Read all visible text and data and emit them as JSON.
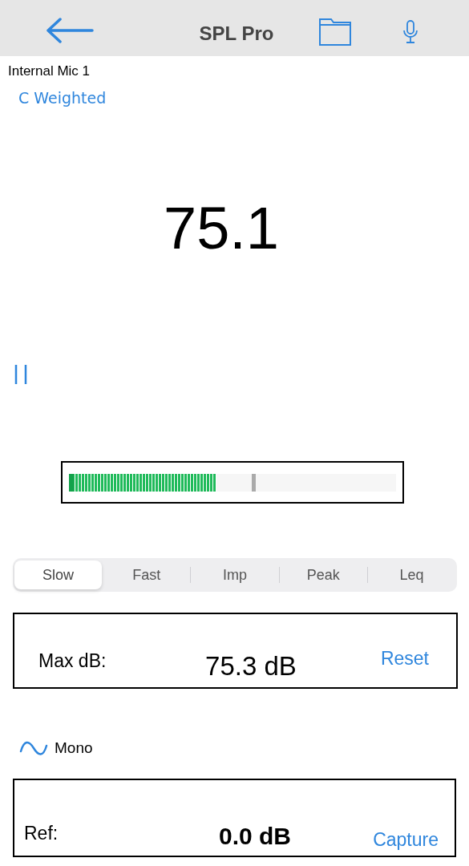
{
  "header": {
    "title": "SPL Pro"
  },
  "input": {
    "device": "Internal Mic 1",
    "weighting": "C Weighted"
  },
  "reading": "75.1",
  "paused": false,
  "meter": {
    "level": 0.45,
    "peak": {
      "level": 0.56
    }
  },
  "response_modes": [
    {
      "label": "Slow",
      "selected": true
    },
    {
      "label": "Fast",
      "selected": false
    },
    {
      "label": "Imp",
      "selected": false
    },
    {
      "label": "Peak",
      "selected": false
    },
    {
      "label": "Leq",
      "selected": false
    }
  ],
  "max_panel": {
    "label": "Max dB:",
    "value": "75.3 dB",
    "action": "Reset"
  },
  "channel": {
    "label": "Mono"
  },
  "ref_panel": {
    "label": "Ref:",
    "value": "0.0 dB",
    "action": "Capture"
  }
}
